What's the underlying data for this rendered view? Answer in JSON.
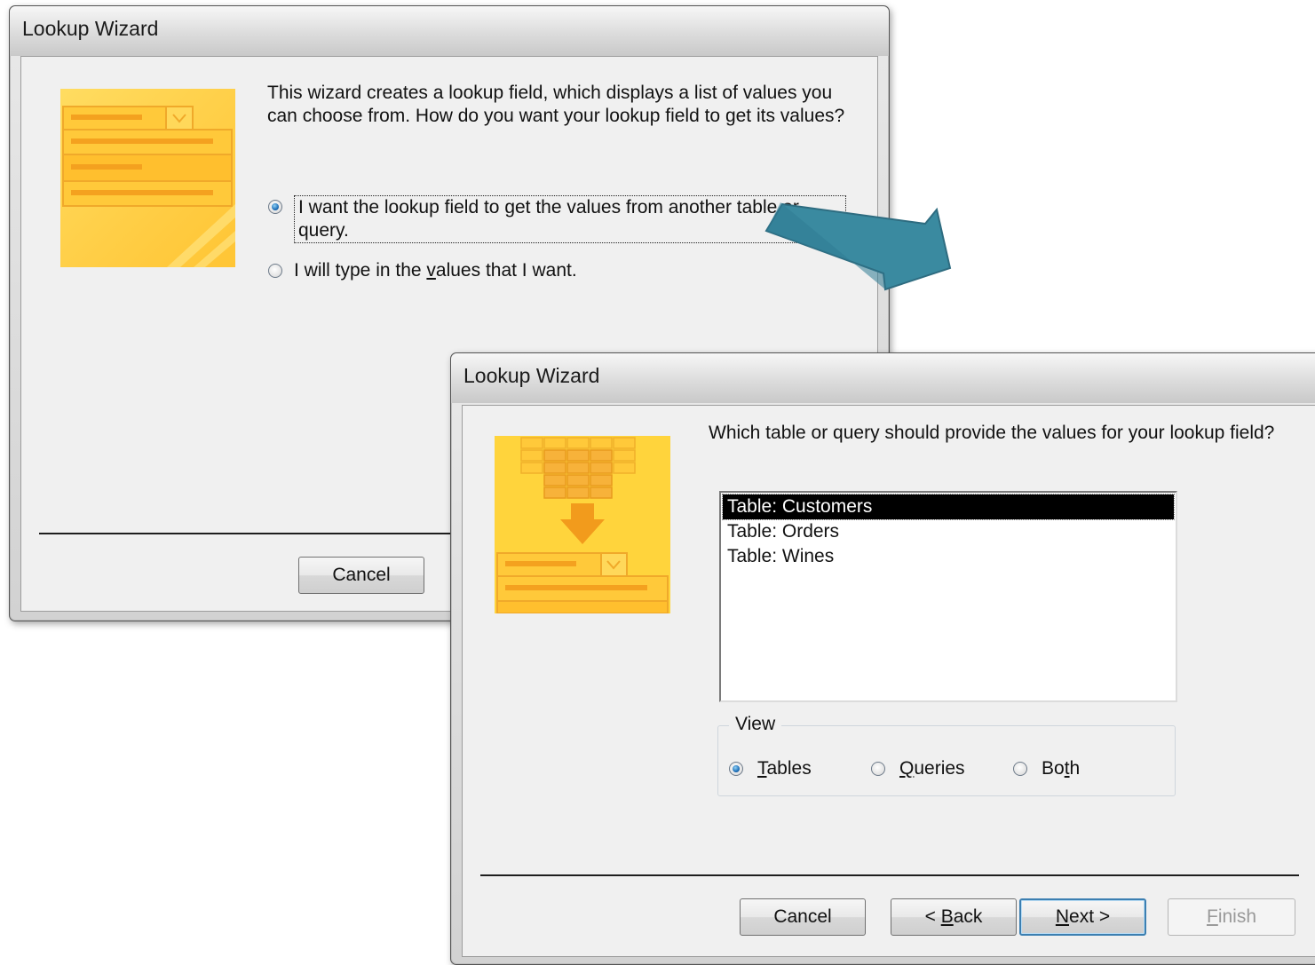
{
  "colors": {
    "accent_arrow": "#3a8aa0",
    "icon_yellow": "#ffd43c",
    "icon_orange": "#f5a623",
    "selection": "#000000"
  },
  "dialog1": {
    "title": "Lookup Wizard",
    "prompt": "This wizard creates a lookup field, which displays a list of values you can choose from.  How do you want your lookup field to get its values?",
    "option1": "I want the lookup field to get the values from another table or query.",
    "option2_pre": "I will type in the ",
    "option2_u": "v",
    "option2_post": "alues that I want.",
    "cancel": "Cancel",
    "icon": "lookup-list-icon"
  },
  "dialog2": {
    "title": "Lookup Wizard",
    "prompt": "Which table or query should provide the values for your lookup field?",
    "list_items": [
      "Table: Customers",
      "Table: Orders",
      "Table: Wines"
    ],
    "selected_index": 0,
    "view_label": "View",
    "view_tables_u": "T",
    "view_tables_rest": "ables",
    "view_queries_u": "Q",
    "view_queries_rest": "ueries",
    "view_both_pre": "Bo",
    "view_both_u": "t",
    "view_both_post": "h",
    "cancel": "Cancel",
    "back_pre": "< ",
    "back_u": "B",
    "back_post": "ack",
    "next_u": "N",
    "next_post": "ext >",
    "finish_u": "F",
    "finish_post": "inish",
    "icon": "table-to-lookup-icon"
  },
  "arrow_icon": "right-arrow-icon"
}
